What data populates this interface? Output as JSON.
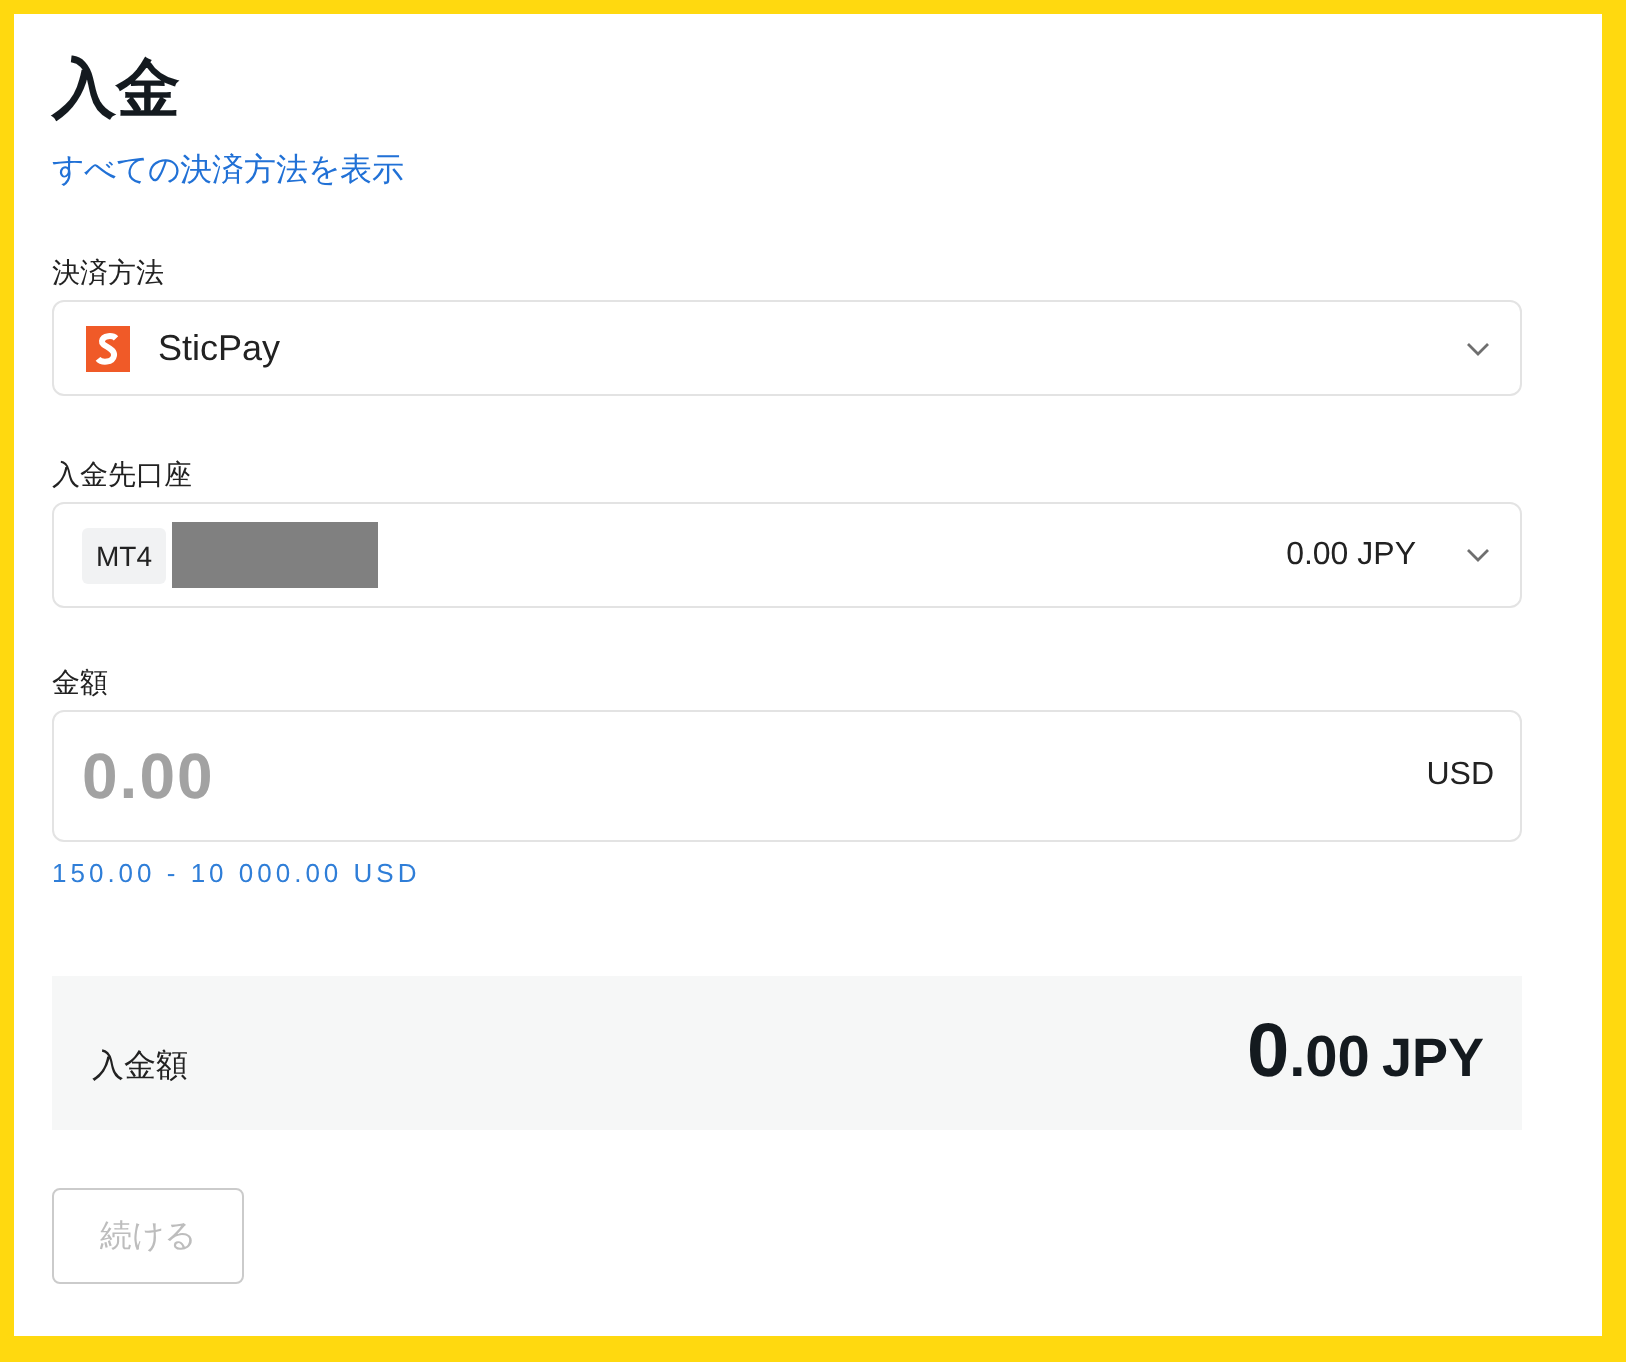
{
  "page": {
    "title": "入金",
    "link": "すべての決済方法を表示"
  },
  "payment_method": {
    "label": "決済方法",
    "value": "SticPay"
  },
  "account": {
    "label": "入金先口座",
    "platform": "MT4",
    "balance": "0.00 JPY"
  },
  "amount": {
    "label": "金額",
    "placeholder": "0.00",
    "currency": "USD",
    "hint": "150.00 - 10 000.00 USD"
  },
  "summary": {
    "label": "入金額",
    "integer": "0",
    "fraction": ".00",
    "currency": "JPY"
  },
  "continue_button": {
    "label": "続ける",
    "disabled": true
  }
}
